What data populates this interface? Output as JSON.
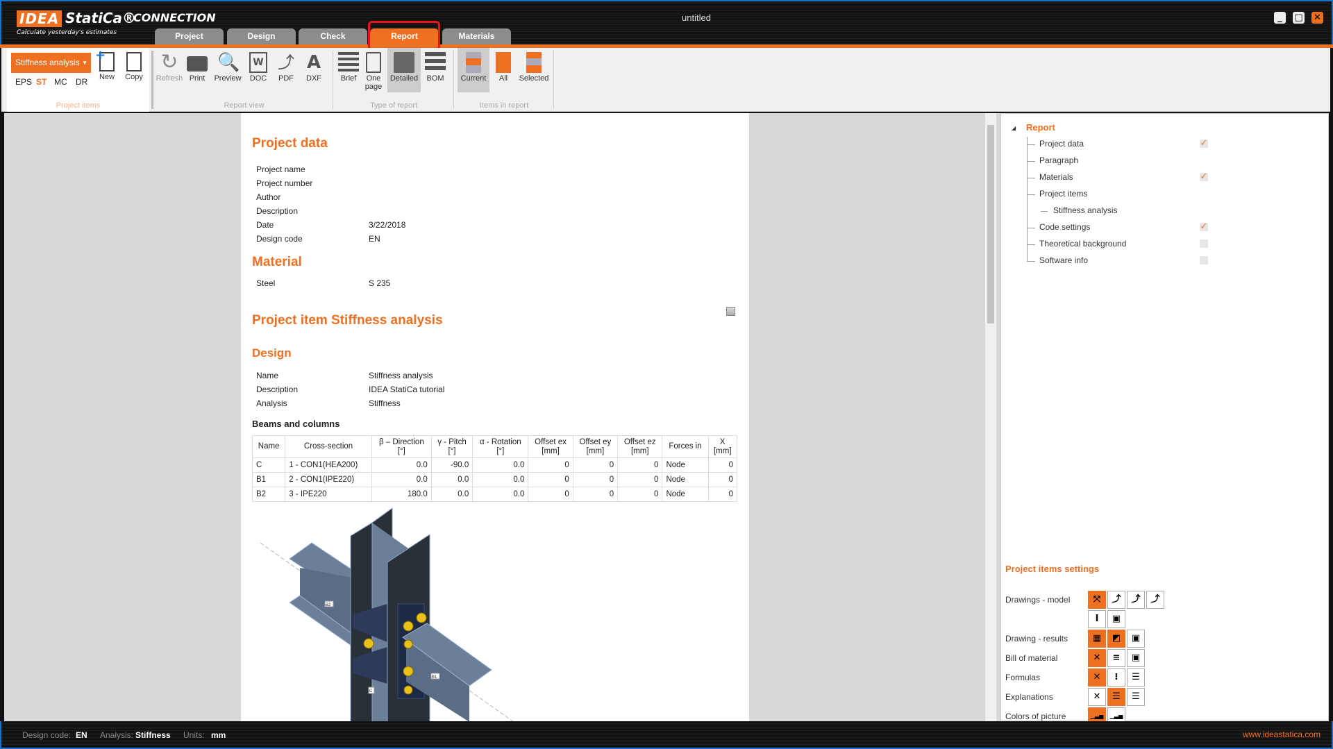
{
  "app": {
    "logo_idea": "IDEA",
    "logo_statica": "StatiCa®",
    "product": "CONNECTION",
    "slogan": "Calculate yesterday's estimates",
    "window_title": "untitled"
  },
  "tabs": [
    {
      "label": "Project"
    },
    {
      "label": "Design"
    },
    {
      "label": "Check"
    },
    {
      "label": "Report",
      "active": true
    },
    {
      "label": "Materials"
    }
  ],
  "ribbon": {
    "project_items": {
      "dropdown": "Stiffness analysis",
      "types": [
        "EPS",
        "ST",
        "MC",
        "DR"
      ],
      "active_type": "ST",
      "new": "New",
      "copy": "Copy",
      "label": "Project items"
    },
    "report_view": {
      "buttons": [
        "Refresh",
        "Print",
        "Preview",
        "DOC",
        "PDF",
        "DXF"
      ],
      "label": "Report view"
    },
    "type_of_report": {
      "buttons": [
        "Brief",
        "One page",
        "Detailed",
        "BOM"
      ],
      "active": "Detailed",
      "label": "Type of report"
    },
    "items_in_report": {
      "buttons": [
        "Current",
        "All",
        "Selected"
      ],
      "active": "Current",
      "label": "Items in report"
    }
  },
  "report": {
    "project_data": {
      "title": "Project data",
      "rows": [
        [
          "Project name",
          ""
        ],
        [
          "Project number",
          ""
        ],
        [
          "Author",
          ""
        ],
        [
          "Description",
          ""
        ],
        [
          "Date",
          "3/22/2018"
        ],
        [
          "Design code",
          "EN"
        ]
      ]
    },
    "material": {
      "title": "Material",
      "rows": [
        [
          "Steel",
          "S 235"
        ]
      ]
    },
    "item_title": "Project item Stiffness analysis",
    "design": {
      "title": "Design",
      "rows": [
        [
          "Name",
          "Stiffness analysis"
        ],
        [
          "Description",
          "IDEA StatiCa tutorial"
        ],
        [
          "Analysis",
          "Stiffness"
        ]
      ]
    },
    "beams": {
      "title": "Beams and columns",
      "headers": [
        [
          "Name",
          ""
        ],
        [
          "Cross-section",
          ""
        ],
        [
          "β – Direction",
          "[°]"
        ],
        [
          "γ - Pitch",
          "[°]"
        ],
        [
          "α - Rotation",
          "[°]"
        ],
        [
          "Offset ex",
          "[mm]"
        ],
        [
          "Offset ey",
          "[mm]"
        ],
        [
          "Offset ez",
          "[mm]"
        ],
        [
          "Forces in",
          ""
        ],
        [
          "X",
          "[mm]"
        ]
      ],
      "rows": [
        [
          "C",
          "1 - CON1(HEA200)",
          "0.0",
          "-90.0",
          "0.0",
          "0",
          "0",
          "0",
          "Node",
          "0"
        ],
        [
          "B1",
          "2 - CON1(IPE220)",
          "0.0",
          "0.0",
          "0.0",
          "0",
          "0",
          "0",
          "Node",
          "0"
        ],
        [
          "B2",
          "3 - IPE220",
          "180.0",
          "0.0",
          "0.0",
          "0",
          "0",
          "0",
          "Node",
          "0"
        ]
      ]
    },
    "model_labels": {
      "b2": "B2",
      "b1": "B1",
      "c": "C"
    }
  },
  "tree": {
    "root": "Report",
    "items": [
      {
        "label": "Project data",
        "checked": true
      },
      {
        "label": "Paragraph"
      },
      {
        "label": "Materials",
        "checked": true
      },
      {
        "label": "Project items"
      },
      {
        "label": "Stiffness analysis",
        "child": true
      },
      {
        "label": "Code settings",
        "checked": true
      },
      {
        "label": "Theoretical background",
        "checked": false
      },
      {
        "label": "Software info",
        "checked": false
      }
    ]
  },
  "settings": {
    "title": "Project items settings",
    "rows": [
      "Drawings - model",
      "Drawing - results",
      "Bill of material",
      "Formulas",
      "Explanations",
      "Colors of picture"
    ]
  },
  "status": {
    "design_code_label": "Design code:",
    "design_code": "EN",
    "analysis_label": "Analysis:",
    "analysis": "Stiffness",
    "units_label": "Units:",
    "units": "mm",
    "website_a": "www.ideastatica",
    "website_b": ".com"
  },
  "colors": {
    "accent": "#f07022",
    "highlight": "#e8141b"
  }
}
